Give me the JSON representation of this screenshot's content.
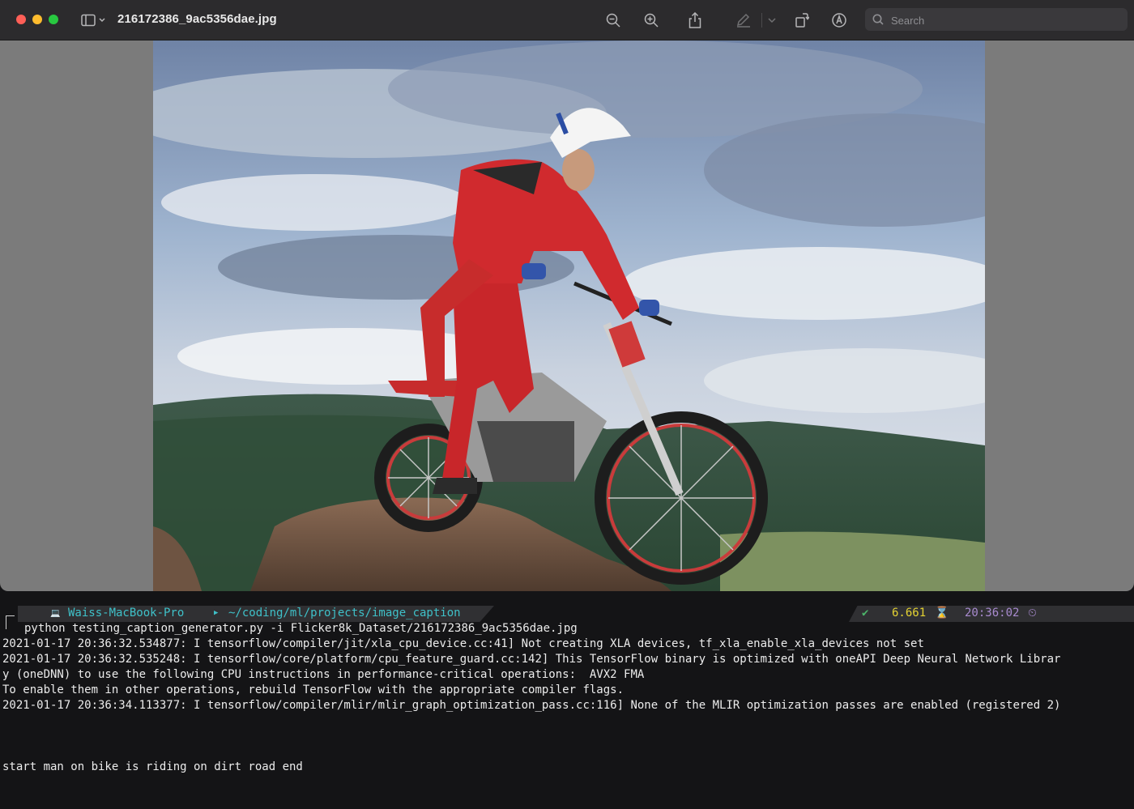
{
  "preview": {
    "title": "216172386_9ac5356dae.jpg",
    "search_placeholder": "Search",
    "icons": [
      "sidebar-icon",
      "chevron-down-icon",
      "zoom-out-icon",
      "zoom-in-icon",
      "share-icon",
      "markup-icon",
      "chevron-down-icon",
      "rotate-icon",
      "annotate-icon",
      "search-icon"
    ]
  },
  "terminal": {
    "prompt": {
      "apple_glyph": "",
      "host_icon": "💻",
      "host": "Waiss-MacBook-Pro",
      "folder_icon": "▶",
      "path": "~/coding/ml/projects/image_caption",
      "status_check": "✔",
      "duration": "6.661",
      "duration_icon": "⌛",
      "time": "20:36:02",
      "time_icon": "⏲"
    },
    "command": "python testing_caption_generator.py -i Flicker8k_Dataset/216172386_9ac5356dae.jpg",
    "output_lines": [
      "2021-01-17 20:36:32.534877: I tensorflow/compiler/jit/xla_cpu_device.cc:41] Not creating XLA devices, tf_xla_enable_xla_devices not set",
      "2021-01-17 20:36:32.535248: I tensorflow/core/platform/cpu_feature_guard.cc:142] This TensorFlow binary is optimized with oneAPI Deep Neural Network Librar",
      "y (oneDNN) to use the following CPU instructions in performance-critical operations:  AVX2 FMA",
      "To enable them in other operations, rebuild TensorFlow with the appropriate compiler flags.",
      "2021-01-17 20:36:34.113377: I tensorflow/compiler/mlir/mlir_graph_optimization_pass.cc:116] None of the MLIR optimization passes are enabled (registered 2)"
    ],
    "caption": "start man on bike is riding on dirt road end"
  },
  "colors": {
    "prompt_cyan": "#3fc1c9",
    "prompt_yellow": "#e4d232",
    "prompt_purple": "#a98bd0",
    "status_green": "#4db56a"
  }
}
